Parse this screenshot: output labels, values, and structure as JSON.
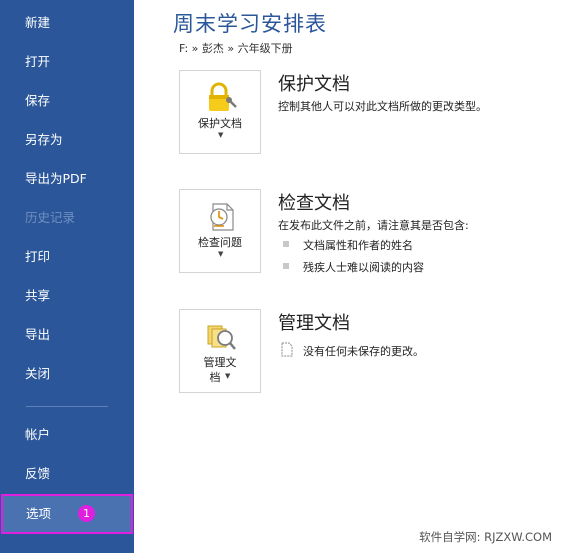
{
  "sidebar": {
    "items": [
      {
        "label": "新建"
      },
      {
        "label": "打开"
      },
      {
        "label": "保存"
      },
      {
        "label": "另存为"
      },
      {
        "label": "导出为PDF"
      },
      {
        "label": "历史记录"
      },
      {
        "label": "打印"
      },
      {
        "label": "共享"
      },
      {
        "label": "导出"
      },
      {
        "label": "关闭"
      },
      {
        "label": "帐户"
      },
      {
        "label": "反馈"
      },
      {
        "label": "选项"
      }
    ],
    "options_badge": "1",
    "colors": {
      "background": "#2b579a",
      "highlight": "#e020e0"
    }
  },
  "main": {
    "title": "周末学习安排表",
    "breadcrumb": "F: » 彭杰 » 六年级下册",
    "sections": [
      {
        "button_label": "保护文档",
        "icon": "lock-key-icon",
        "heading": "保护文档",
        "description": "控制其他人可以对此文档所做的更改类型。"
      },
      {
        "button_label": "检查问题",
        "icon": "inspect-document-icon",
        "heading": "检查文档",
        "description": "在发布此文件之前，请注意其是否包含:",
        "bullets": [
          "文档属性和作者的姓名",
          "残疾人士难以阅读的内容"
        ]
      },
      {
        "button_label_line1": "管理文",
        "button_label_line2": "档",
        "icon": "manage-document-icon",
        "heading": "管理文档",
        "note": "没有任何未保存的更改。"
      }
    ]
  },
  "watermark": "软件自学网: RJZXW.COM"
}
